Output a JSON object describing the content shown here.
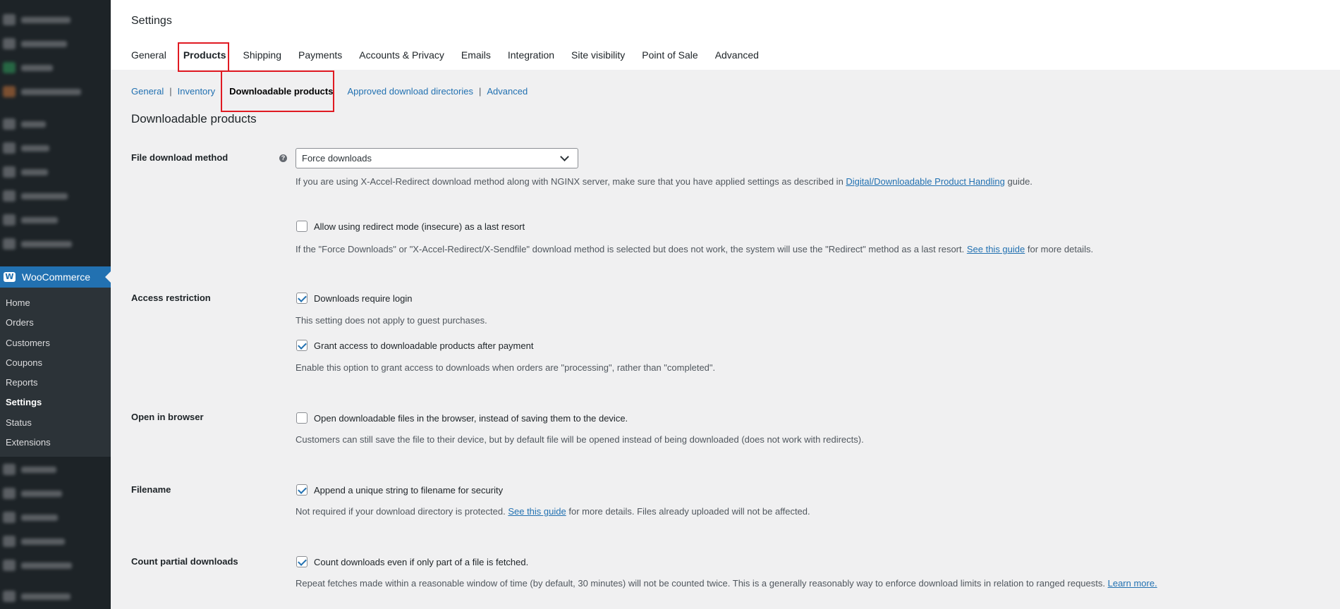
{
  "sidebar": {
    "woocommerce_label": "WooCommerce",
    "submenu": [
      "Home",
      "Orders",
      "Customers",
      "Coupons",
      "Reports",
      "Settings",
      "Status",
      "Extensions"
    ],
    "current": "Settings"
  },
  "header": {
    "title": "Settings",
    "tabs": [
      "General",
      "Products",
      "Shipping",
      "Payments",
      "Accounts & Privacy",
      "Emails",
      "Integration",
      "Site visibility",
      "Point of Sale",
      "Advanced"
    ],
    "active_tab": "Products"
  },
  "subnav": {
    "items": [
      "General",
      "Inventory",
      "Downloadable products",
      "Approved download directories",
      "Advanced"
    ],
    "separator": "|",
    "current": "Downloadable products"
  },
  "section_title": "Downloadable products",
  "fields": {
    "file_download_method": {
      "label": "File download method",
      "help_icon": "?",
      "value": "Force downloads",
      "desc_before": "If you are using X-Accel-Redirect download method along with NGINX server, make sure that you have applied settings as described in ",
      "desc_link": "Digital/Downloadable Product Handling",
      "desc_after": " guide."
    },
    "redirect_fallback": {
      "label": "Allow using redirect mode (insecure) as a last resort",
      "checked": false,
      "desc_before": "If the \"Force Downloads\" or \"X-Accel-Redirect/X-Sendfile\" download method is selected but does not work, the system will use the \"Redirect\" method as a last resort. ",
      "desc_link": "See this guide",
      "desc_after": " for more details."
    },
    "access_restriction": {
      "label": "Access restriction",
      "require_login_label": "Downloads require login",
      "require_login_checked": true,
      "require_login_desc": "This setting does not apply to guest purchases.",
      "grant_access_label": "Grant access to downloadable products after payment",
      "grant_access_checked": true,
      "grant_access_desc": "Enable this option to grant access to downloads when orders are \"processing\", rather than \"completed\"."
    },
    "open_in_browser": {
      "label": "Open in browser",
      "option_label": "Open downloadable files in the browser, instead of saving them to the device.",
      "checked": false,
      "desc": "Customers can still save the file to their device, but by default file will be opened instead of being downloaded (does not work with redirects)."
    },
    "filename": {
      "label": "Filename",
      "option_label": "Append a unique string to filename for security",
      "checked": true,
      "desc_before": "Not required if your download directory is protected. ",
      "desc_link": "See this guide",
      "desc_after": " for more details. Files already uploaded will not be affected."
    },
    "count_partial": {
      "label": "Count partial downloads",
      "option_label": "Count downloads even if only part of a file is fetched.",
      "checked": true,
      "desc_before": "Repeat fetches made within a reasonable window of time (by default, 30 minutes) will not be counted twice. This is a generally reasonably way to enforce download limits in relation to ranged requests. ",
      "desc_link": "Learn more."
    }
  },
  "colors": {
    "sidebar_bg": "#1d2327",
    "accent": "#2271b1",
    "highlight": "#e01a22"
  }
}
